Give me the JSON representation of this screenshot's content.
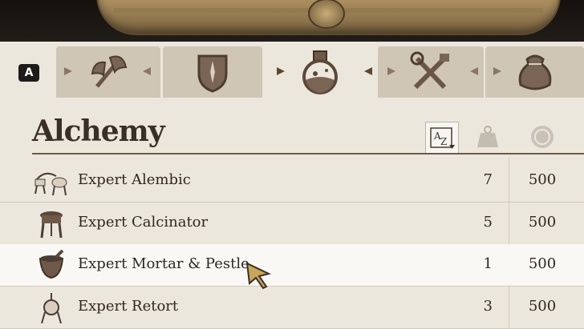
{
  "category_title": "Alchemy",
  "key_hint": "A",
  "tabs": [
    {
      "icon": "axe-icon",
      "active": false
    },
    {
      "icon": "shield-icon",
      "active": false
    },
    {
      "icon": "potion-icon",
      "active": true
    },
    {
      "icon": "tools-icon",
      "active": false
    },
    {
      "icon": "pouch-icon",
      "active": false
    }
  ],
  "columns": {
    "sort_icon": "sort-az-icon",
    "weight_icon": "weight-icon",
    "price_icon": "coin-icon"
  },
  "items": [
    {
      "name": "Expert Alembic",
      "weight": "7",
      "price": "500",
      "icon": "alembic-icon",
      "selected": false
    },
    {
      "name": "Expert Calcinator",
      "weight": "5",
      "price": "500",
      "icon": "calcinator-icon",
      "selected": false
    },
    {
      "name": "Expert Mortar & Pestle",
      "weight": "1",
      "price": "500",
      "icon": "mortar-icon",
      "selected": true
    },
    {
      "name": "Expert Retort",
      "weight": "3",
      "price": "500",
      "icon": "retort-icon",
      "selected": false
    }
  ]
}
